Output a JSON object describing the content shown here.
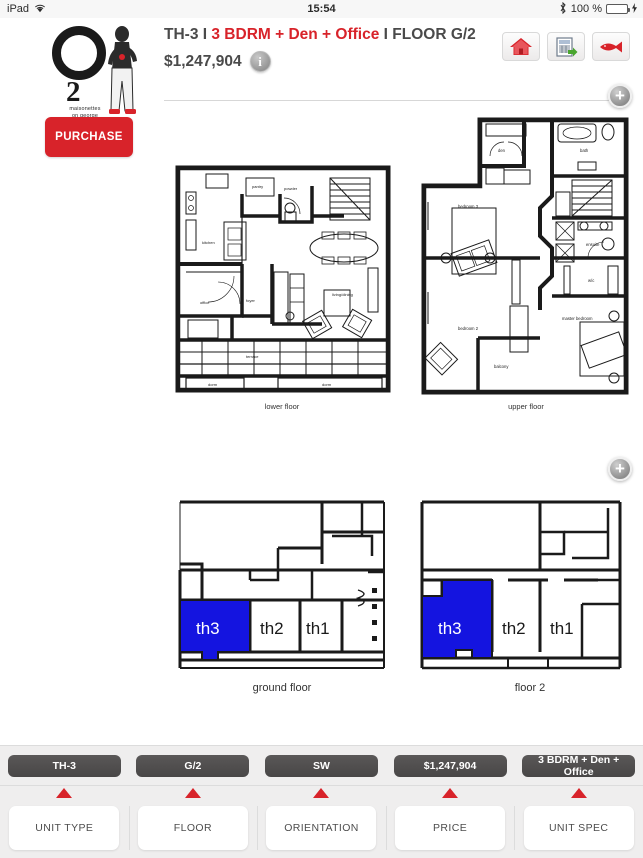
{
  "status_bar": {
    "device": "iPad",
    "wifi_icon": "wifi-icon",
    "time": "15:54",
    "bluetooth_icon": "bluetooth-icon",
    "battery_percent": "100 %",
    "battery_icon": "battery-charging-icon"
  },
  "brand": {
    "mark_letter": "O",
    "mark_number": "2",
    "tagline_line1": "maisonettes",
    "tagline_line2": "on george"
  },
  "header": {
    "unit_code": "TH-3",
    "separator": " I ",
    "unit_spec": "3 BDRM + Den + Office",
    "floor_label": "FLOOR G/2",
    "price": "$1,247,904",
    "info_icon": "info-icon",
    "info_glyph": "i"
  },
  "toolbar": {
    "items": [
      {
        "name": "home-icon",
        "label": "Home"
      },
      {
        "name": "spec-sheet-export-icon",
        "label": "Spec Sheet"
      },
      {
        "name": "fish-icon",
        "label": "Fish"
      }
    ]
  },
  "purchase_button": {
    "label": "PURCHASE",
    "color": "#d8232a"
  },
  "plans": {
    "detail_zoom_label": "+",
    "key_zoom_label": "+",
    "detail": [
      {
        "caption": "lower floor"
      },
      {
        "caption": "upper floor"
      }
    ],
    "key_plans": [
      {
        "caption": "ground floor",
        "units": [
          {
            "label": "th3",
            "selected": true
          },
          {
            "label": "th2",
            "selected": false
          },
          {
            "label": "th1",
            "selected": false
          }
        ]
      },
      {
        "caption": "floor 2",
        "units": [
          {
            "label": "th3",
            "selected": true
          },
          {
            "label": "th2",
            "selected": false
          },
          {
            "label": "th1",
            "selected": false
          }
        ]
      }
    ],
    "selected_unit_color": "#1414e0"
  },
  "filters": [
    {
      "chip": "TH-3",
      "button": "UNIT TYPE"
    },
    {
      "chip": "G/2",
      "button": "FLOOR"
    },
    {
      "chip": "SW",
      "button": "ORIENTATION"
    },
    {
      "chip": "$1,247,904",
      "button": "PRICE"
    },
    {
      "chip": "3 BDRM + Den + Office",
      "button": "UNIT SPEC"
    }
  ]
}
